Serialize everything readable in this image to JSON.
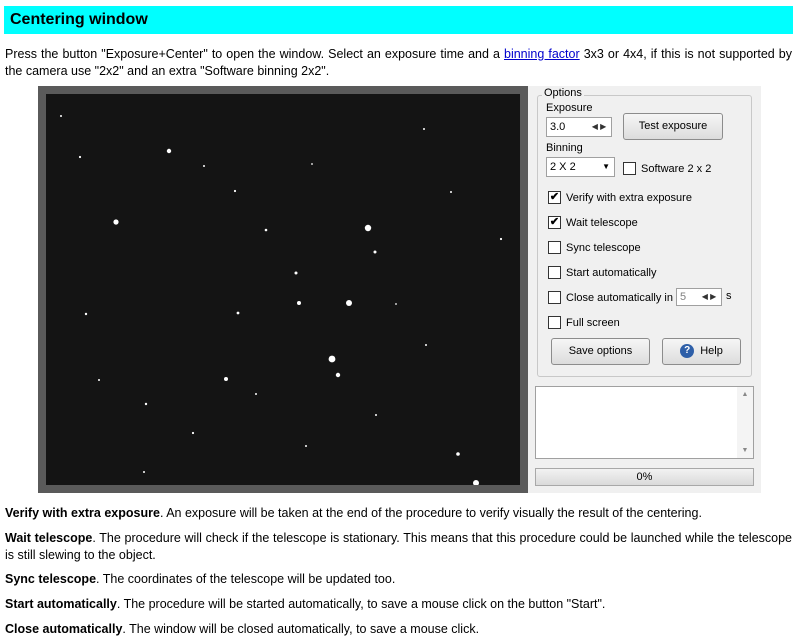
{
  "header": {
    "title": "Centering window"
  },
  "intro": {
    "text_before": "Press the button \"Exposure+Center\" to open the window. Select an exposure time and a ",
    "link": "binning factor",
    "text_after": " 3x3 or 4x4, if this is not supported by the camera use \"2x2\" and an extra \"Software binning 2x2\"."
  },
  "window": {
    "options_legend": "Options",
    "exposure_label": "Exposure",
    "exposure_value": "3.0",
    "test_exposure_button": "Test exposure",
    "binning_label": "Binning",
    "binning_value": "2 X 2",
    "software_binning_label": "Software 2 x 2",
    "software_binning_checked": false,
    "checkboxes": [
      {
        "label": "Verify with extra exposure",
        "checked": true
      },
      {
        "label": "Wait telescope",
        "checked": true
      },
      {
        "label": "Sync telescope",
        "checked": false
      },
      {
        "label": "Start automatically",
        "checked": false
      },
      {
        "label": "Close automatically in",
        "checked": false
      },
      {
        "label": "Full screen",
        "checked": false
      }
    ],
    "close_seconds_value": "5",
    "close_seconds_unit": "s",
    "save_options_button": "Save options",
    "help_button": "Help",
    "progress_text": "0%",
    "progress_fraction": 0
  },
  "descriptions": [
    {
      "term": "Verify with extra exposure",
      "text": ". An exposure will be taken at the end of the procedure to verify visually the result of the centering."
    },
    {
      "term": "Wait telescope",
      "text": ". The procedure will check if the telescope is stationary. This means that this procedure could be launched while the telescope is still slewing to the object."
    },
    {
      "term": "Sync telescope",
      "text": ". The coordinates of the telescope will be updated too."
    },
    {
      "term": "Start automatically",
      "text": ". The procedure will be started automatically, to save a mouse click on the button \"Start\"."
    },
    {
      "term": "Close automatically",
      "text": ". The window will be closed automatically, to save a mouse click."
    }
  ]
}
